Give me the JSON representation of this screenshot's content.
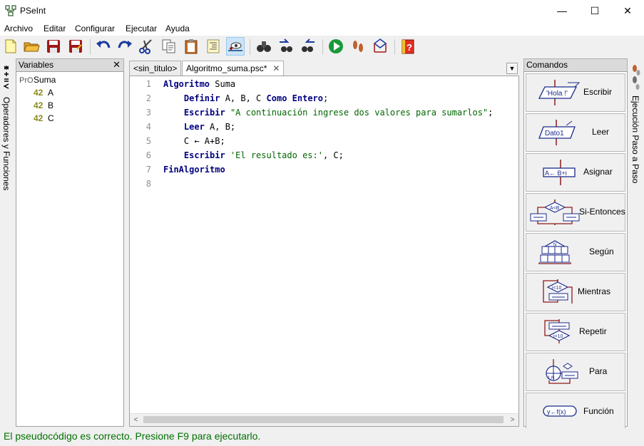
{
  "window": {
    "title": "PSeInt",
    "minimize": "—",
    "maximize": "☐",
    "close": "✕"
  },
  "menu": [
    "Archivo",
    "Editar",
    "Configurar",
    "Ejecutar",
    "Ayuda"
  ],
  "left_strip": {
    "label": "Operadores y Funciones"
  },
  "variables": {
    "title": "Variables",
    "close": "✕",
    "root": {
      "icon_text": "PrO",
      "label": "Suma"
    },
    "items": [
      {
        "type": "42",
        "name": "A"
      },
      {
        "type": "42",
        "name": "B"
      },
      {
        "type": "42",
        "name": "C"
      }
    ]
  },
  "tabs": [
    {
      "label": "<sin_titulo>",
      "active": false
    },
    {
      "label": "Algoritmo_suma.psc*",
      "active": true,
      "close": "✕"
    }
  ],
  "editor": {
    "line_numbers": [
      "1",
      "2",
      "3",
      "4",
      "5",
      "6",
      "7",
      "8"
    ],
    "lines": [
      [
        {
          "t": "Algoritmo",
          "k": "kw"
        },
        {
          "t": " Suma",
          "k": ""
        }
      ],
      [
        {
          "t": "    ",
          "k": ""
        },
        {
          "t": "Definir",
          "k": "kw"
        },
        {
          "t": " A, B, C ",
          "k": ""
        },
        {
          "t": "Como Entero",
          "k": "kw"
        },
        {
          "t": ";",
          "k": ""
        }
      ],
      [
        {
          "t": "    ",
          "k": ""
        },
        {
          "t": "Escribir",
          "k": "kw"
        },
        {
          "t": " ",
          "k": ""
        },
        {
          "t": "\"A continuación ingrese dos valores para sumarlos\"",
          "k": "str"
        },
        {
          "t": ";",
          "k": ""
        }
      ],
      [
        {
          "t": "    ",
          "k": ""
        },
        {
          "t": "Leer",
          "k": "kw"
        },
        {
          "t": " A, B;",
          "k": ""
        }
      ],
      [
        {
          "t": "    C ← A+B;",
          "k": ""
        }
      ],
      [
        {
          "t": "    ",
          "k": ""
        },
        {
          "t": "Escribir",
          "k": "kw"
        },
        {
          "t": " ",
          "k": ""
        },
        {
          "t": "'El resultado es:'",
          "k": "str"
        },
        {
          "t": ", C;",
          "k": ""
        }
      ],
      [
        {
          "t": "FinAlgoritmo",
          "k": "kw"
        }
      ],
      []
    ]
  },
  "commands": {
    "title": "Comandos",
    "items": [
      {
        "id": "escribir",
        "label": "Escribir",
        "icon_text": "'Hola !'"
      },
      {
        "id": "leer",
        "label": "Leer",
        "icon_text": "Dato1"
      },
      {
        "id": "asignar",
        "label": "Asignar",
        "icon_text": "A← B+i"
      },
      {
        "id": "si-entonces",
        "label": "Si-Entonces",
        "icon_text": "A<B"
      },
      {
        "id": "segun",
        "label": "Según",
        "icon_text": "N"
      },
      {
        "id": "mientras",
        "label": "Mientras",
        "icon_text": "i<10"
      },
      {
        "id": "repetir",
        "label": "Repetir",
        "icon_text": "i>10"
      },
      {
        "id": "para",
        "label": "Para",
        "icon_text": "1,N"
      },
      {
        "id": "funcion",
        "label": "Función",
        "icon_text": "y←f(x)"
      }
    ]
  },
  "right_strip": {
    "label": "Ejecución Paso a Paso"
  },
  "status": {
    "text": "El pseudocódigo es correcto. Presione F9 para ejecutarlo."
  },
  "colors": {
    "keyword": "#00007f",
    "string": "#006600",
    "status": "#007000",
    "diagram_red": "#8b1a1a",
    "diagram_blue": "#1a2a8b"
  }
}
